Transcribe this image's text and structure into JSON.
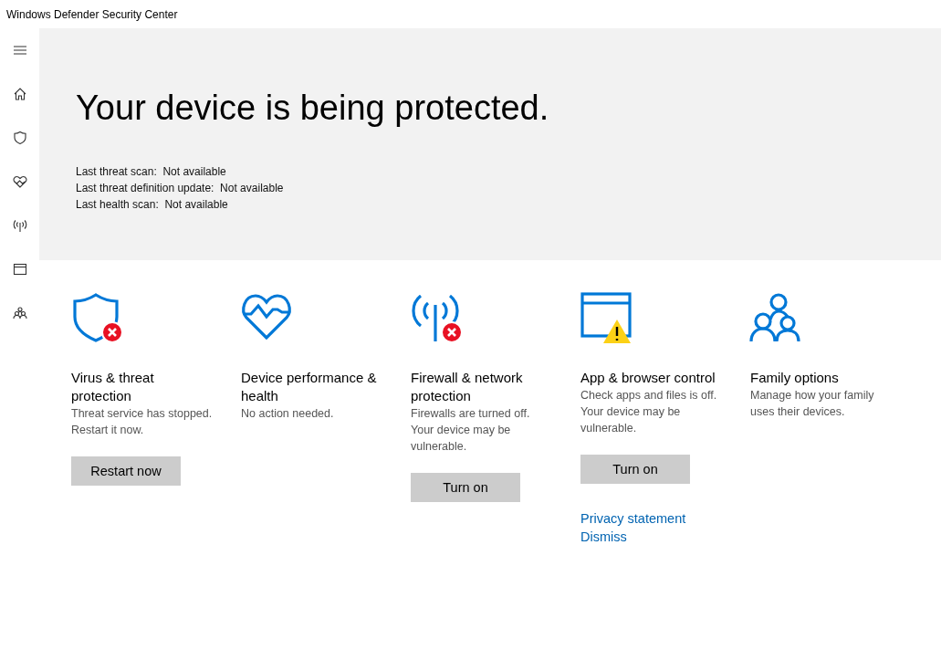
{
  "window": {
    "title": "Windows Defender Security Center"
  },
  "sidebar": {
    "items": [
      {
        "kind": "menu"
      },
      {
        "kind": "home"
      },
      {
        "kind": "shield"
      },
      {
        "kind": "heart"
      },
      {
        "kind": "antenna"
      },
      {
        "kind": "window"
      },
      {
        "kind": "family"
      }
    ]
  },
  "hero": {
    "headline": "Your device is being protected.",
    "details": [
      "Last threat scan:  Not available",
      "Last threat definition update:  Not available",
      "Last health scan:  Not available"
    ]
  },
  "cards": [
    {
      "kind": "shield-error",
      "title": "Virus & threat protection",
      "description": "Threat service has stopped. Restart it now.",
      "button": "Restart now"
    },
    {
      "kind": "heart",
      "title": "Device performance & health",
      "description": "No action needed."
    },
    {
      "kind": "antenna-error",
      "title": "Firewall & network protection",
      "description": "Firewalls are turned off. Your device may be vulnerable.",
      "button": "Turn on"
    },
    {
      "kind": "window-warning",
      "title": "App & browser control",
      "description": "Check apps and files is off. Your device may be vulnerable.",
      "button": "Turn on",
      "links": [
        "Privacy statement",
        "Dismiss"
      ]
    },
    {
      "kind": "family",
      "title": "Family options",
      "description": "Manage how your family uses their devices."
    }
  ]
}
